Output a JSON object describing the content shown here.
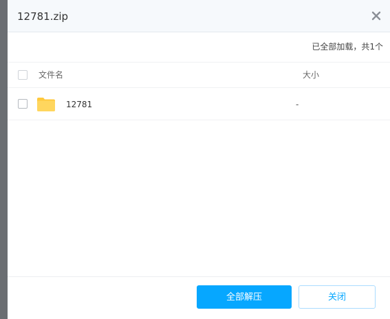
{
  "dialog": {
    "title": "12781.zip",
    "close_icon": "close-icon"
  },
  "status": {
    "text": "已全部加载，共1个"
  },
  "table": {
    "columns": {
      "name": "文件名",
      "size": "大小"
    },
    "rows": [
      {
        "icon": "folder-icon",
        "name": "12781",
        "size": "-"
      }
    ]
  },
  "footer": {
    "extract_all_label": "全部解压",
    "close_label": "关闭"
  },
  "colors": {
    "accent": "#06a7ff",
    "folder": "#ffd25c",
    "overlay": "#6b6e72"
  }
}
